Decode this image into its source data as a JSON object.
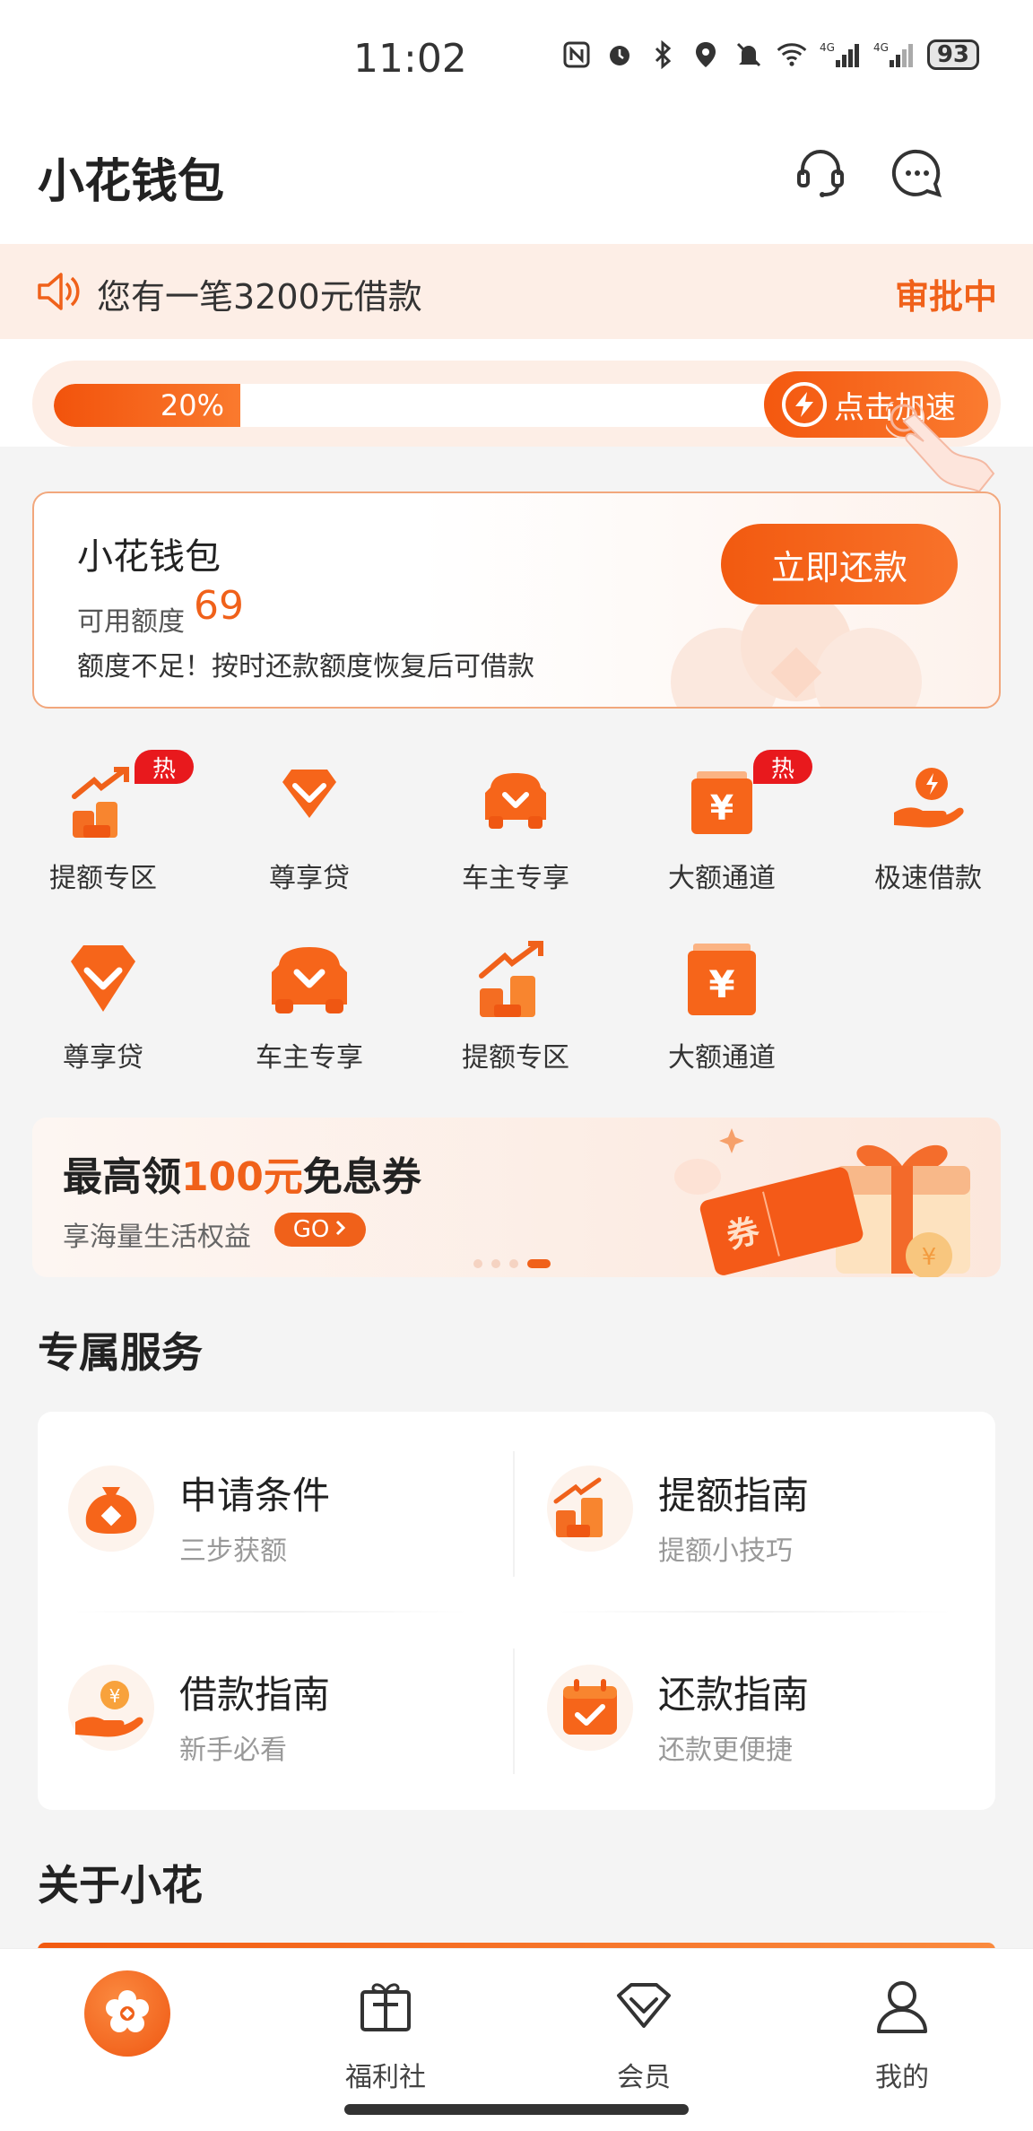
{
  "status_bar": {
    "time": "11:02",
    "battery": "93",
    "net1": "4G",
    "net2": "4G"
  },
  "header": {
    "title": "小花钱包"
  },
  "notice": {
    "text": "您有一笔3200元借款",
    "status": "审批中"
  },
  "progress": {
    "label": "20%",
    "value": 0.2,
    "speed_button": "点击加速"
  },
  "wallet": {
    "name": "小花钱包",
    "limit_label": "可用额度",
    "limit_value": "69",
    "tip": "额度不足！按时还款额度恢复后可借款",
    "repay_button": "立即还款"
  },
  "grid": {
    "items": [
      {
        "label": "提额专区",
        "hot": "热"
      },
      {
        "label": "尊享贷"
      },
      {
        "label": "车主专享"
      },
      {
        "label": "大额通道",
        "hot": "热"
      },
      {
        "label": "极速借款"
      },
      {
        "label": "尊享贷"
      },
      {
        "label": "车主专享"
      },
      {
        "label": "提额专区"
      },
      {
        "label": "大额通道"
      }
    ]
  },
  "banner": {
    "title_prefix": "最高领",
    "title_highlight": "100元",
    "title_suffix": "免息券",
    "subtitle": "享海量生活权益",
    "go_label": "GO",
    "coupon_text": "券"
  },
  "services": {
    "title": "专属服务",
    "items": [
      {
        "title": "申请条件",
        "subtitle": "三步获额"
      },
      {
        "title": "提额指南",
        "subtitle": "提额小技巧"
      },
      {
        "title": "借款指南",
        "subtitle": "新手必看"
      },
      {
        "title": "还款指南",
        "subtitle": "还款更便捷"
      }
    ]
  },
  "about": {
    "title": "关于小花"
  },
  "bottom_nav": {
    "items": [
      {
        "label": ""
      },
      {
        "label": "福利社"
      },
      {
        "label": "会员"
      },
      {
        "label": "我的"
      }
    ]
  },
  "colors": {
    "accent": "#f0611a",
    "hot": "#e8191d",
    "notice_bg": "#fdeee6"
  }
}
